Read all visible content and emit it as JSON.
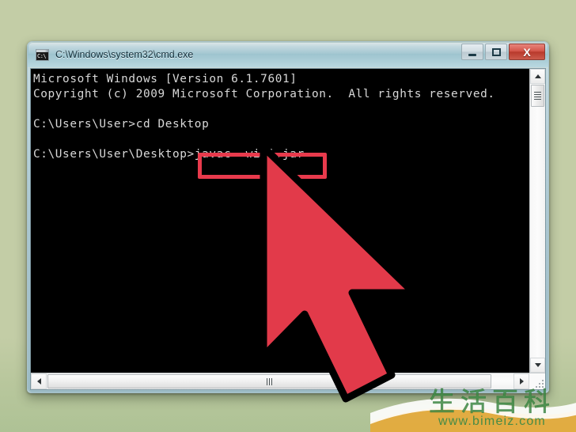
{
  "window": {
    "title": "C:\\Windows\\system32\\cmd.exe",
    "icon": "cmd-console-icon",
    "icon_prompt": "C:\\",
    "controls": {
      "minimize_label": "–",
      "maximize_label": "□",
      "close_label": "X"
    }
  },
  "console": {
    "lines": [
      "Microsoft Windows [Version 6.1.7601]",
      "Copyright (c) 2009 Microsoft Corporation.  All rights reserved.",
      "",
      "C:\\Users\\User>cd Desktop",
      "",
      "C:\\Users\\User\\Desktop>javac -wiki.jar"
    ],
    "highlighted_command": "javac -wiki.jar",
    "background_color": "#000000",
    "text_color": "#d8d8d8"
  },
  "annotation": {
    "highlight_color": "#e83a4c",
    "cursor_color": "#e23a4a",
    "cursor_outline_color": "#000000",
    "cursor_name": "pointer-arrow"
  },
  "scrollbars": {
    "vertical": {
      "up_arrow": "scroll-up-arrow",
      "down_arrow": "scroll-down-arrow",
      "thumb": "vertical-scroll-thumb"
    },
    "horizontal": {
      "left_arrow": "scroll-left-arrow",
      "right_arrow": "scroll-right-arrow",
      "thumb": "horizontal-scroll-thumb"
    }
  },
  "watermark": {
    "characters": "生活百科",
    "url": "www.bimeiz.com",
    "color": "#3f8a46"
  },
  "page": {
    "background_color": "#c3cda6"
  }
}
